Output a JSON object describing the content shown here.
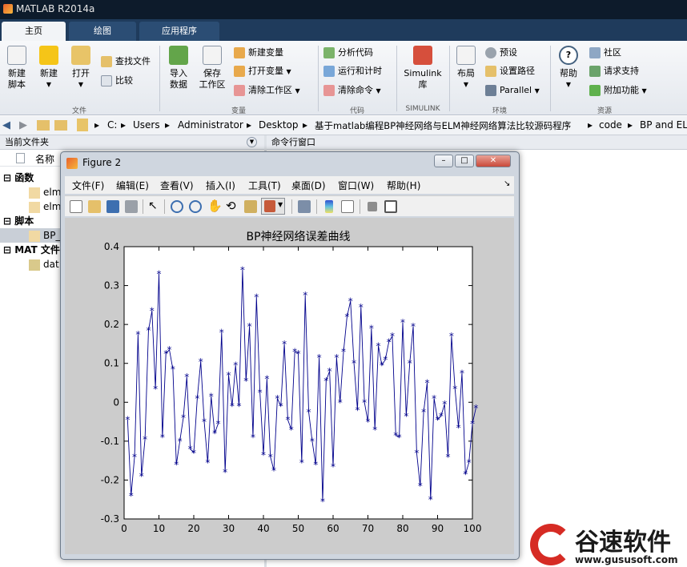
{
  "window": {
    "title": "MATLAB R2014a"
  },
  "tabs": [
    {
      "label": "主页"
    },
    {
      "label": "绘图"
    },
    {
      "label": "应用程序"
    }
  ],
  "ribbon": {
    "new_script": "新建\n脚本",
    "new": "新建",
    "open": "打开",
    "find_files": "查找文件",
    "compare": "比较",
    "import_data": "导入\n数据",
    "save_workspace": "保存\n工作区",
    "new_variable": "新建变量",
    "open_variable": "打开变量",
    "clear_workspace": "清除工作区",
    "analyze_code": "分析代码",
    "run_and_time": "运行和计时",
    "clear_commands": "清除命令",
    "simulink": "Simulink\n库",
    "layout": "布局",
    "preferences": "预设",
    "set_path": "设置路径",
    "parallel": "Parallel",
    "help": "帮助",
    "community": "社区",
    "request_support": "请求支持",
    "addons": "附加功能",
    "groups": {
      "file": "文件",
      "variable": "变量",
      "code": "代码",
      "simulink": "SIMULINK",
      "environment": "环境",
      "resources": "资源"
    }
  },
  "address": {
    "segments": [
      "C:",
      "Users",
      "Administrator",
      "Desktop",
      "基于matlab编程BP神经网络与ELM神经网络算法比较源码程序",
      "code",
      "BP and EL"
    ]
  },
  "current_folder": {
    "title": "当前文件夹",
    "name_col": "名称",
    "tree": [
      {
        "label": "函数",
        "type": "header"
      },
      {
        "label": "elm",
        "type": "file"
      },
      {
        "label": "elm",
        "type": "file"
      },
      {
        "label": "脚本",
        "type": "header"
      },
      {
        "label": "BP_",
        "type": "file",
        "selected": true
      },
      {
        "label": "MAT 文件",
        "type": "header"
      },
      {
        "label": "dat",
        "type": "file"
      }
    ]
  },
  "command_window": {
    "title": "命令行窗口"
  },
  "figure": {
    "title": "Figure 2",
    "menu": [
      "文件(F)",
      "编辑(E)",
      "查看(V)",
      "插入(I)",
      "工具(T)",
      "桌面(D)",
      "窗口(W)",
      "帮助(H)"
    ]
  },
  "chart_data": {
    "type": "line",
    "title": "BP神经网络误差曲线",
    "xlabel": "",
    "ylabel": "",
    "xlim": [
      0,
      100
    ],
    "ylim": [
      -0.3,
      0.4
    ],
    "xticks": [
      "0",
      "10",
      "20",
      "30",
      "40",
      "50",
      "60",
      "70",
      "80",
      "90",
      "100"
    ],
    "yticks": [
      "0.4",
      "0.3",
      "0.2",
      "0.1",
      "0",
      "-0.1",
      "-0.2",
      "-0.3"
    ],
    "marker": "*",
    "color": "#00008b",
    "series": [
      {
        "values": [
          -0.045,
          -0.24,
          -0.14,
          0.175,
          -0.19,
          -0.095,
          0.185,
          0.235,
          0.035,
          0.33,
          -0.09,
          0.125,
          0.135,
          0.085,
          -0.16,
          -0.1,
          -0.04,
          0.065,
          -0.12,
          -0.13,
          0.01,
          0.105,
          -0.05,
          -0.155,
          0.015,
          -0.08,
          -0.055,
          0.18,
          -0.18,
          0.07,
          -0.01,
          0.095,
          -0.01,
          0.34,
          0.055,
          0.195,
          -0.09,
          0.27,
          0.025,
          -0.135,
          0.06,
          -0.14,
          -0.175,
          0.01,
          -0.01,
          0.15,
          -0.045,
          -0.07,
          0.13,
          0.125,
          -0.155,
          0.275,
          -0.025,
          -0.1,
          -0.16,
          0.115,
          -0.255,
          0.055,
          0.08,
          -0.165,
          0.115,
          0.0,
          0.13,
          0.22,
          0.26,
          0.1,
          -0.02,
          0.245,
          0.0,
          -0.05,
          0.19,
          -0.07,
          0.145,
          0.095,
          0.11,
          0.155,
          0.17,
          -0.085,
          -0.09,
          0.205,
          -0.035,
          0.1,
          0.195,
          -0.13,
          -0.215,
          -0.025,
          0.05,
          -0.25,
          0.01,
          -0.045,
          -0.035,
          -0.005,
          -0.14,
          0.17,
          0.035,
          -0.065,
          0.075,
          -0.185,
          -0.155,
          -0.055,
          -0.015
        ]
      }
    ]
  },
  "watermark": {
    "text": "谷速软件",
    "url": "www.gususoft.com"
  }
}
